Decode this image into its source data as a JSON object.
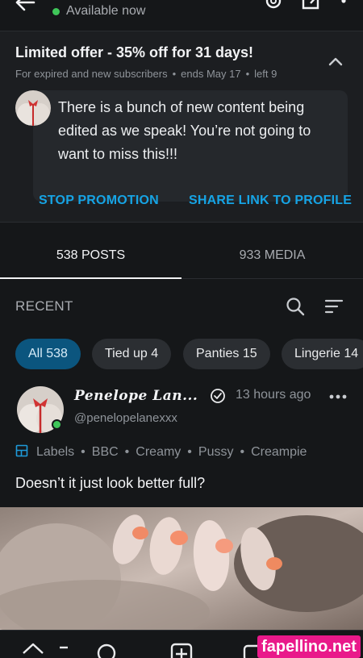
{
  "header": {
    "status_text": "Available now",
    "status_color": "#3fc659",
    "icons": [
      "back-arrow-icon",
      "settings-icon",
      "share-icon",
      "more-vertical-icon"
    ]
  },
  "promo": {
    "title": "Limited offer - 35% off for 31 days!",
    "audience": "For expired and new subscribers",
    "ends": "ends May 17",
    "left": "left 9",
    "message": "There is a bunch of new content being edited as we speak! You’re not going to want to miss this!!!",
    "stop_label": "STOP PROMOTION",
    "share_label": "SHARE LINK TO PROFILE",
    "accent_color": "#16a4e5"
  },
  "tabs": [
    {
      "label": "538 POSTS",
      "active": true
    },
    {
      "label": "933 MEDIA",
      "active": false
    }
  ],
  "recent_label": "RECENT",
  "chips": [
    {
      "label": "All 538",
      "active": true
    },
    {
      "label": "Tied up 4",
      "active": false
    },
    {
      "label": "Panties 15",
      "active": false
    },
    {
      "label": "Lingerie 14",
      "active": false
    }
  ],
  "post": {
    "display_name": "Penelope Lan...",
    "handle": "@penelopelanexxx",
    "time": "13 hours ago",
    "labels_title": "Labels",
    "labels": [
      "BBC",
      "Creamy",
      "Pussy",
      "Creampie"
    ],
    "text": "Doesn’t it just look better full?"
  },
  "nav": {
    "icons": [
      "home-icon",
      "list-icon",
      "search-icon",
      "add-post-icon",
      "messages-icon"
    ]
  },
  "watermark": "fapellino.net"
}
